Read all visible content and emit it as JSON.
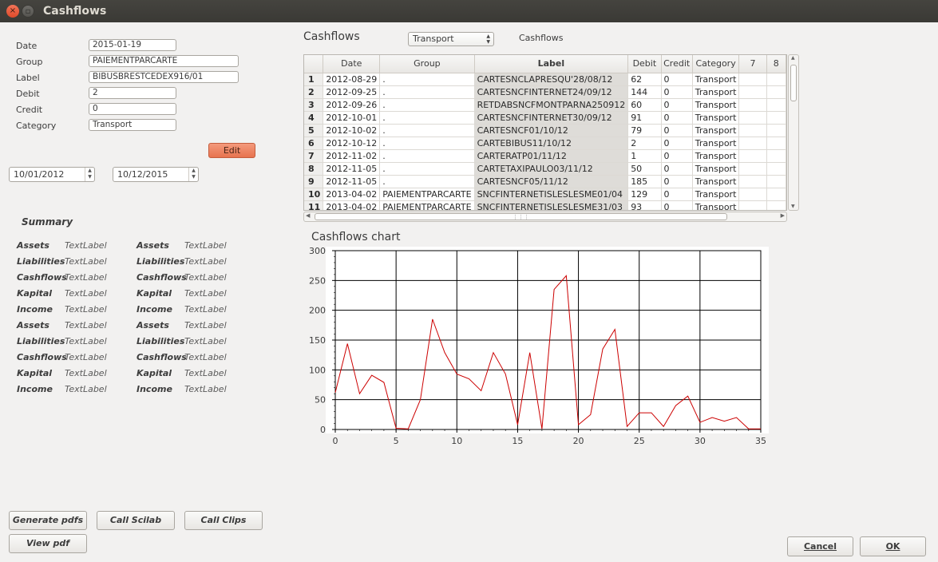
{
  "window": {
    "title": "Cashflows",
    "close_glyph": "×",
    "max_glyph": "▫"
  },
  "form": {
    "date_label": "Date",
    "date_value": "2015-01-19",
    "group_label": "Group",
    "group_value": "PAIEMENTPARCARTE",
    "label_label": "Label",
    "label_value": "BIBUSBRESTCEDEX916/01",
    "debit_label": "Debit",
    "debit_value": "2",
    "credit_label": "Credit",
    "credit_value": "0",
    "category_label": "Category",
    "category_value": "Transport",
    "edit_button": "Edit",
    "start_date": "10/01/2012",
    "end_date": "10/12/2015",
    "edit_color": "#e7734f"
  },
  "summary": {
    "title": "Summary",
    "left": [
      {
        "key": "Assets",
        "value": "TextLabel"
      },
      {
        "key": "Liabilities",
        "value": "TextLabel"
      },
      {
        "key": "Cashflows",
        "value": "TextLabel"
      },
      {
        "key": "Kapital",
        "value": "TextLabel"
      },
      {
        "key": "Income",
        "value": "TextLabel"
      },
      {
        "key": "Assets",
        "value": "TextLabel"
      },
      {
        "key": "Liabilities",
        "value": "TextLabel"
      },
      {
        "key": "Cashflows",
        "value": "TextLabel"
      },
      {
        "key": "Kapital",
        "value": "TextLabel"
      },
      {
        "key": "Income",
        "value": "TextLabel"
      }
    ],
    "right": [
      {
        "key": "Assets",
        "value": "TextLabel"
      },
      {
        "key": "Liabilities",
        "value": "TextLabel"
      },
      {
        "key": "Cashflows",
        "value": "TextLabel"
      },
      {
        "key": "Kapital",
        "value": "TextLabel"
      },
      {
        "key": "Income",
        "value": "TextLabel"
      },
      {
        "key": "Assets",
        "value": "TextLabel"
      },
      {
        "key": "Liabilities",
        "value": "TextLabel"
      },
      {
        "key": "Cashflows",
        "value": "TextLabel"
      },
      {
        "key": "Kapital",
        "value": "TextLabel"
      },
      {
        "key": "Income",
        "value": "TextLabel"
      }
    ]
  },
  "buttons": {
    "generate_pdfs": "Generate pdfs",
    "call_scilab": "Call Scilab",
    "call_clips": "Call Clips",
    "view_pdf": "View pdf",
    "cancel": "Cancel",
    "ok": "OK"
  },
  "cashflows": {
    "title": "Cashflows",
    "category_select": "Transport",
    "side_label": "Cashflows",
    "columns": [
      "Date",
      "Group",
      "Label",
      "Debit",
      "Credit",
      "Category",
      "7",
      "8"
    ],
    "rows": [
      {
        "n": "1",
        "date": "2012-08-29",
        "group": ".",
        "label": "CARTESNCLAPRESQU'28/08/12",
        "debit": "62",
        "credit": "0",
        "category": "Transport"
      },
      {
        "n": "2",
        "date": "2012-09-25",
        "group": ".",
        "label": "CARTESNCFINTERNET24/09/12",
        "debit": "144",
        "credit": "0",
        "category": "Transport"
      },
      {
        "n": "3",
        "date": "2012-09-26",
        "group": ".",
        "label": "RETDABSNCFMONTPARNA250912",
        "debit": "60",
        "credit": "0",
        "category": "Transport"
      },
      {
        "n": "4",
        "date": "2012-10-01",
        "group": ".",
        "label": "CARTESNCFINTERNET30/09/12",
        "debit": "91",
        "credit": "0",
        "category": "Transport"
      },
      {
        "n": "5",
        "date": "2012-10-02",
        "group": ".",
        "label": "CARTESNCF01/10/12",
        "debit": "79",
        "credit": "0",
        "category": "Transport"
      },
      {
        "n": "6",
        "date": "2012-10-12",
        "group": ".",
        "label": "CARTEBIBUS11/10/12",
        "debit": "2",
        "credit": "0",
        "category": "Transport"
      },
      {
        "n": "7",
        "date": "2012-11-02",
        "group": ".",
        "label": "CARTERATP01/11/12",
        "debit": "1",
        "credit": "0",
        "category": "Transport"
      },
      {
        "n": "8",
        "date": "2012-11-05",
        "group": ".",
        "label": "CARTETAXIPAULO03/11/12",
        "debit": "50",
        "credit": "0",
        "category": "Transport"
      },
      {
        "n": "9",
        "date": "2012-11-05",
        "group": ".",
        "label": "CARTESNCF05/11/12",
        "debit": "185",
        "credit": "0",
        "category": "Transport"
      },
      {
        "n": "10",
        "date": "2013-04-02",
        "group": "PAIEMENTPARCARTE",
        "label": "SNCFINTERNETISLESLESME01/04",
        "debit": "129",
        "credit": "0",
        "category": "Transport"
      },
      {
        "n": "11",
        "date": "2013-04-02",
        "group": "PAIEMENTPARCARTE",
        "label": "SNCFINTERNETISLESLESME31/03",
        "debit": "93",
        "credit": "0",
        "category": "Transport"
      }
    ],
    "scroll_grip": "⋮⋮⋮"
  },
  "chart_title": "Cashflows chart",
  "chart_data": {
    "type": "line",
    "title": "",
    "xlabel": "",
    "ylabel": "",
    "xlim": [
      0,
      35
    ],
    "ylim": [
      0,
      300
    ],
    "x_ticks": [
      0,
      5,
      10,
      15,
      20,
      25,
      30,
      35
    ],
    "y_ticks": [
      0,
      50,
      100,
      150,
      200,
      250,
      300
    ],
    "grid": true,
    "line_color": "#cc0000",
    "x": [
      0,
      1,
      2,
      3,
      4,
      5,
      6,
      7,
      8,
      9,
      10,
      11,
      12,
      13,
      14,
      15,
      16,
      17,
      18,
      19,
      20,
      21,
      22,
      23,
      24,
      25,
      26,
      27,
      28,
      29,
      30,
      31,
      32,
      33,
      34,
      35
    ],
    "y": [
      62,
      144,
      60,
      91,
      79,
      2,
      1,
      50,
      185,
      129,
      93,
      85,
      65,
      129,
      93,
      8,
      129,
      1,
      235,
      258,
      8,
      25,
      135,
      168,
      5,
      28,
      28,
      5,
      40,
      56,
      12,
      20,
      14,
      20,
      1,
      1
    ]
  }
}
